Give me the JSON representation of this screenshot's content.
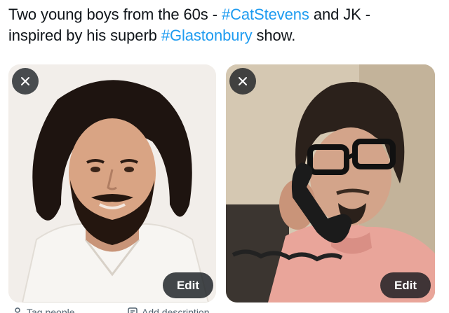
{
  "tweet": {
    "line1_prefix": "Two young boys from the 60s - ",
    "hashtag1": "#CatStevens",
    "line1_suffix": " and JK -",
    "line2_prefix": "inspired by his superb ",
    "hashtag2": "#Glastonbury",
    "line2_suffix": " show."
  },
  "media": [
    {
      "remove_icon": "close-icon",
      "edit_label": "Edit"
    },
    {
      "remove_icon": "close-icon",
      "edit_label": "Edit"
    }
  ],
  "footer": {
    "tag_label": "Tag people",
    "tag_icon": "person-icon",
    "description_label": "Add description",
    "description_icon": "description-icon"
  },
  "colors": {
    "text": "#0f1419",
    "hashtag": "#1d9bf0",
    "overlay_button": "#0f1419",
    "secondary_text": "#536471"
  }
}
